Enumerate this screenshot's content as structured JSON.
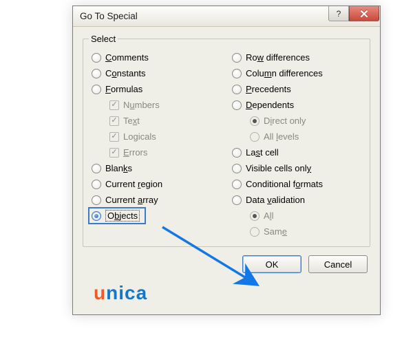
{
  "dialog": {
    "title": "Go To Special",
    "groupLabel": "Select",
    "left": [
      {
        "name": "opt-comments",
        "type": "radio",
        "indent": false,
        "disabled": false,
        "selected": false,
        "pre": "",
        "ul": "C",
        "post": "omments"
      },
      {
        "name": "opt-constants",
        "type": "radio",
        "indent": false,
        "disabled": false,
        "selected": false,
        "pre": "C",
        "ul": "o",
        "post": "nstants"
      },
      {
        "name": "opt-formulas",
        "type": "radio",
        "indent": false,
        "disabled": false,
        "selected": false,
        "pre": "",
        "ul": "F",
        "post": "ormulas"
      },
      {
        "name": "chk-numbers",
        "type": "check",
        "indent": true,
        "disabled": true,
        "selected": true,
        "pre": "N",
        "ul": "u",
        "post": "mbers"
      },
      {
        "name": "chk-text",
        "type": "check",
        "indent": true,
        "disabled": true,
        "selected": true,
        "pre": "Te",
        "ul": "x",
        "post": "t"
      },
      {
        "name": "chk-logicals",
        "type": "check",
        "indent": true,
        "disabled": true,
        "selected": true,
        "pre": "Lo",
        "ul": "g",
        "post": "icals"
      },
      {
        "name": "chk-errors",
        "type": "check",
        "indent": true,
        "disabled": true,
        "selected": true,
        "pre": "",
        "ul": "E",
        "post": "rrors"
      },
      {
        "name": "opt-blanks",
        "type": "radio",
        "indent": false,
        "disabled": false,
        "selected": false,
        "pre": "Blan",
        "ul": "k",
        "post": "s"
      },
      {
        "name": "opt-current-region",
        "type": "radio",
        "indent": false,
        "disabled": false,
        "selected": false,
        "pre": "Current ",
        "ul": "r",
        "post": "egion"
      },
      {
        "name": "opt-current-array",
        "type": "radio",
        "indent": false,
        "disabled": false,
        "selected": false,
        "pre": "Current ",
        "ul": "a",
        "post": "rray"
      },
      {
        "name": "opt-objects",
        "type": "radio",
        "indent": false,
        "disabled": false,
        "selected": true,
        "focus": true,
        "pre": "O",
        "ul": "b",
        "post": "jects"
      }
    ],
    "right": [
      {
        "name": "opt-row-differences",
        "type": "radio",
        "indent": false,
        "disabled": false,
        "selected": false,
        "pre": "Ro",
        "ul": "w",
        "post": " differences"
      },
      {
        "name": "opt-column-differences",
        "type": "radio",
        "indent": false,
        "disabled": false,
        "selected": false,
        "pre": "Colu",
        "ul": "m",
        "post": "n differences"
      },
      {
        "name": "opt-precedents",
        "type": "radio",
        "indent": false,
        "disabled": false,
        "selected": false,
        "pre": "",
        "ul": "P",
        "post": "recedents"
      },
      {
        "name": "opt-dependents",
        "type": "radio",
        "indent": false,
        "disabled": false,
        "selected": false,
        "pre": "",
        "ul": "D",
        "post": "ependents"
      },
      {
        "name": "opt-direct-only",
        "type": "radio",
        "indent": true,
        "disabled": true,
        "selected": true,
        "pre": "D",
        "ul": "i",
        "post": "rect only"
      },
      {
        "name": "opt-all-levels",
        "type": "radio",
        "indent": true,
        "disabled": true,
        "selected": false,
        "pre": "All ",
        "ul": "l",
        "post": "evels"
      },
      {
        "name": "opt-last-cell",
        "type": "radio",
        "indent": false,
        "disabled": false,
        "selected": false,
        "pre": "La",
        "ul": "s",
        "post": "t cell"
      },
      {
        "name": "opt-visible-cells",
        "type": "radio",
        "indent": false,
        "disabled": false,
        "selected": false,
        "pre": "Visible cells onl",
        "ul": "y",
        "post": ""
      },
      {
        "name": "opt-conditional-formats",
        "type": "radio",
        "indent": false,
        "disabled": false,
        "selected": false,
        "pre": "Conditional f",
        "ul": "o",
        "post": "rmats"
      },
      {
        "name": "opt-data-validation",
        "type": "radio",
        "indent": false,
        "disabled": false,
        "selected": false,
        "pre": "Data ",
        "ul": "v",
        "post": "alidation"
      },
      {
        "name": "opt-all",
        "type": "radio",
        "indent": true,
        "disabled": true,
        "selected": true,
        "pre": "A",
        "ul": "l",
        "post": "l"
      },
      {
        "name": "opt-same",
        "type": "radio",
        "indent": true,
        "disabled": true,
        "selected": false,
        "pre": "Sam",
        "ul": "e",
        "post": ""
      }
    ],
    "buttons": {
      "ok": "OK",
      "cancel": "Cancel"
    }
  },
  "watermark": {
    "first": "u",
    "rest": "nica"
  }
}
